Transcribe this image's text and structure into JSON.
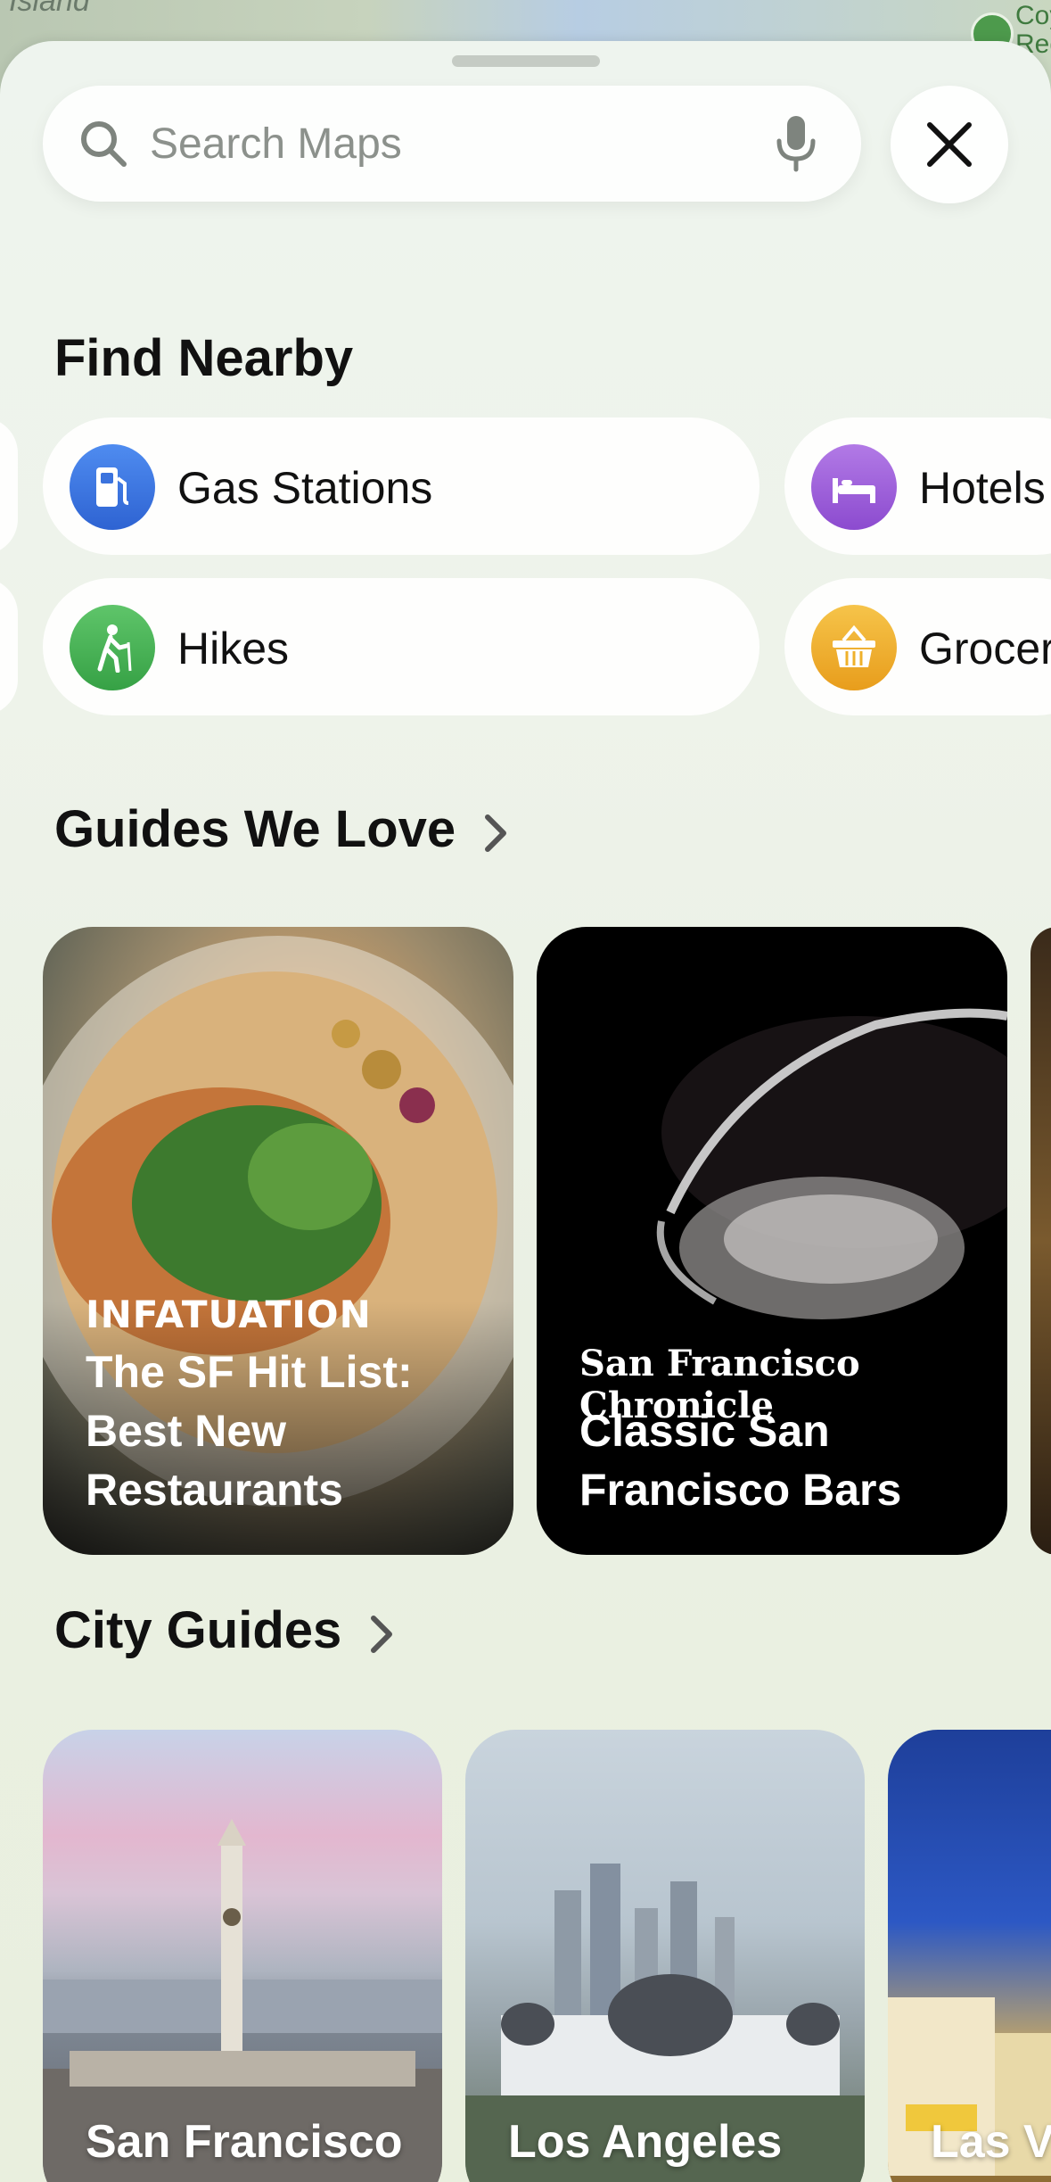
{
  "map": {
    "left_label": "Island",
    "right_label": "Coy Reg"
  },
  "search": {
    "placeholder": "Search Maps",
    "search_icon": "magnifying-glass",
    "mic_icon": "microphone",
    "close_icon": "x-mark"
  },
  "find_nearby": {
    "title": "Find Nearby",
    "items": [
      {
        "label": "Gas Stations",
        "icon": "fuel-pump",
        "color": "#3b73de"
      },
      {
        "label": "Hotels",
        "icon": "bed",
        "color": "#9b5ed8"
      },
      {
        "label": "Hikes",
        "icon": "hiker",
        "color": "#44b153"
      },
      {
        "label": "Grocer",
        "icon": "basket",
        "color": "#efb12b"
      }
    ]
  },
  "guides": {
    "title": "Guides We Love",
    "cards": [
      {
        "brand": "INFATUATION",
        "title": "The SF Hit List: Best New Restaurants"
      },
      {
        "brand": "San Francisco Chronicle",
        "title": "Classic San Francisco Bars"
      }
    ]
  },
  "city_guides": {
    "title": "City Guides",
    "cards": [
      {
        "name": "San Francisco"
      },
      {
        "name": "Los Angeles"
      },
      {
        "name": "Las V"
      }
    ]
  }
}
